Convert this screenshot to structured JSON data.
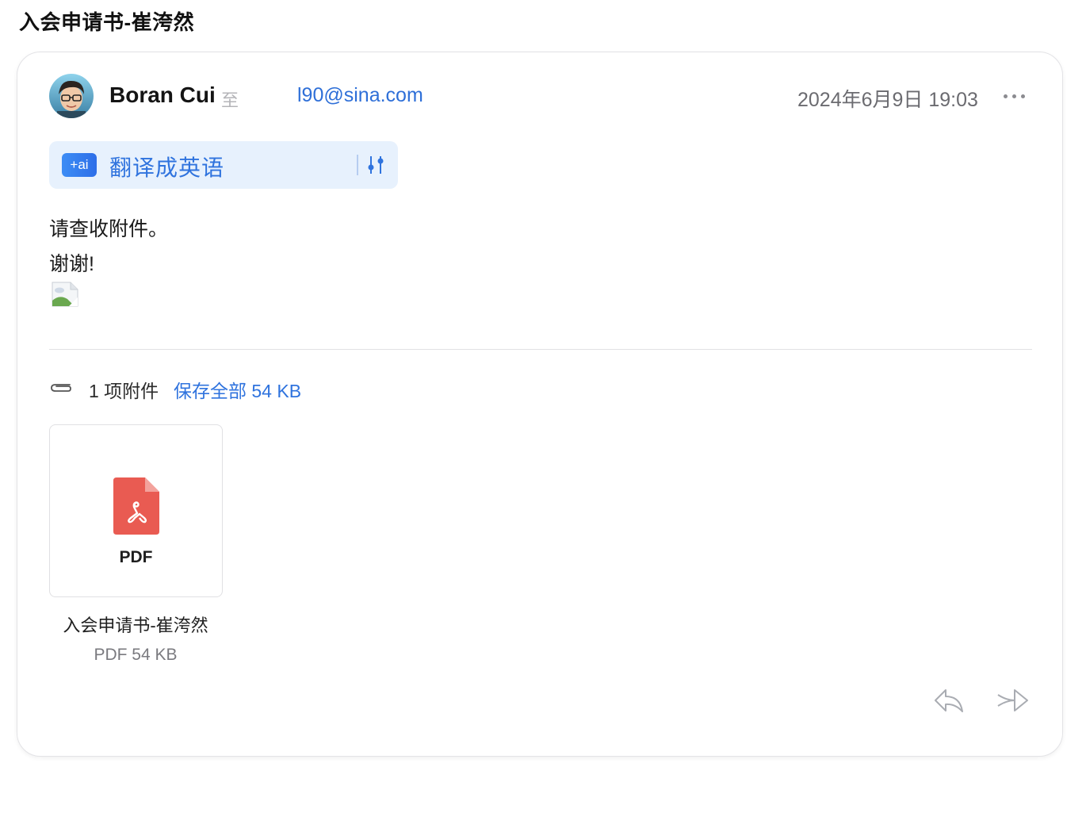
{
  "subject": "入会申请书-崔洿然",
  "header": {
    "sender_name": "Boran Cui",
    "to_label": "至",
    "recipient": "l90@sina.com",
    "date": "2024年6月9日 19:03"
  },
  "translate": {
    "badge": "+ai",
    "label": "翻译成英语"
  },
  "body": {
    "lines": [
      "请查收附件。",
      "谢谢!"
    ]
  },
  "attachments": {
    "count_label": "1 项附件",
    "save_all_label": "保存全部 54 KB",
    "files": [
      {
        "type_label": "PDF",
        "name": "入会申请书-崔洿然",
        "meta": "PDF 54 KB"
      }
    ]
  },
  "colors": {
    "accent": "#2f73de",
    "pdf_red": "#e95b52",
    "translate_bg": "#e7f1fd"
  },
  "icons": {
    "more": "more-icon",
    "settings": "settings-icon",
    "attachment": "paperclip-icon",
    "reply": "reply-icon",
    "forward": "forward-icon",
    "pdf": "pdf-file-icon"
  }
}
